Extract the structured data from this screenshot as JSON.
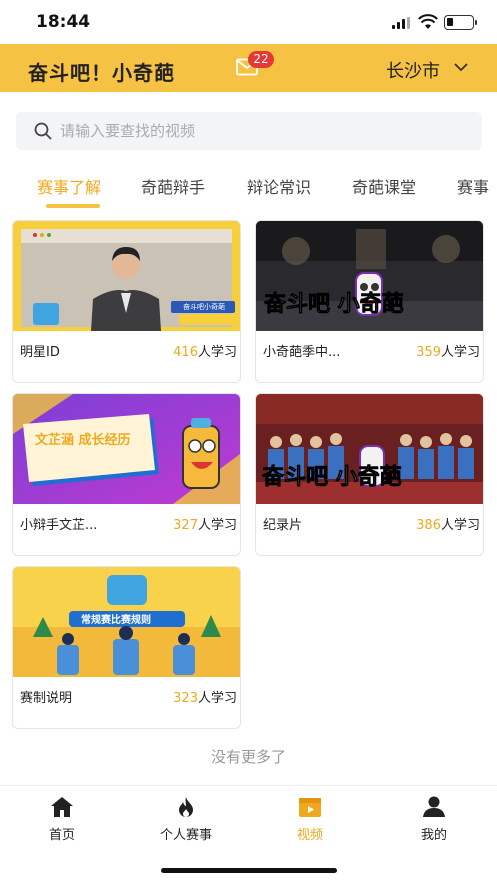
{
  "status_bar": {
    "time": "18:44"
  },
  "header": {
    "title": "奋斗吧！小奇葩",
    "mail_badge": "22",
    "city": "长沙市"
  },
  "search": {
    "placeholder": "请输入要查找的视频"
  },
  "tabs": [
    "赛事了解",
    "奇葩辩手",
    "辩论常识",
    "奇葩课堂",
    "赛事"
  ],
  "active_tab": "赛事了解",
  "cards": [
    {
      "title": "明星ID",
      "count": "416",
      "suffix": "人学习",
      "thumb_text": "奋斗吧小奇葩"
    },
    {
      "title": "小奇葩季中...",
      "count": "359",
      "suffix": "人学习",
      "thumb_text": "奋斗吧 小奇葩"
    },
    {
      "title": "小辩手文芷...",
      "count": "327",
      "suffix": "人学习",
      "thumb_text": "文芷涵 成长经历"
    },
    {
      "title": "纪录片",
      "count": "386",
      "suffix": "人学习",
      "thumb_text": "奋斗吧 小奇葩"
    },
    {
      "title": "赛制说明",
      "count": "323",
      "suffix": "人学习",
      "thumb_text": "常规赛比赛规则"
    }
  ],
  "footer_note": "没有更多了",
  "tabbar": [
    {
      "label": "首页",
      "icon": "home-icon"
    },
    {
      "label": "个人赛事",
      "icon": "flame-icon"
    },
    {
      "label": "视频",
      "icon": "video-icon"
    },
    {
      "label": "我的",
      "icon": "user-icon"
    }
  ],
  "colors": {
    "accent": "#f6c243",
    "accent_text": "#f0a91f",
    "badge": "#e53935"
  }
}
